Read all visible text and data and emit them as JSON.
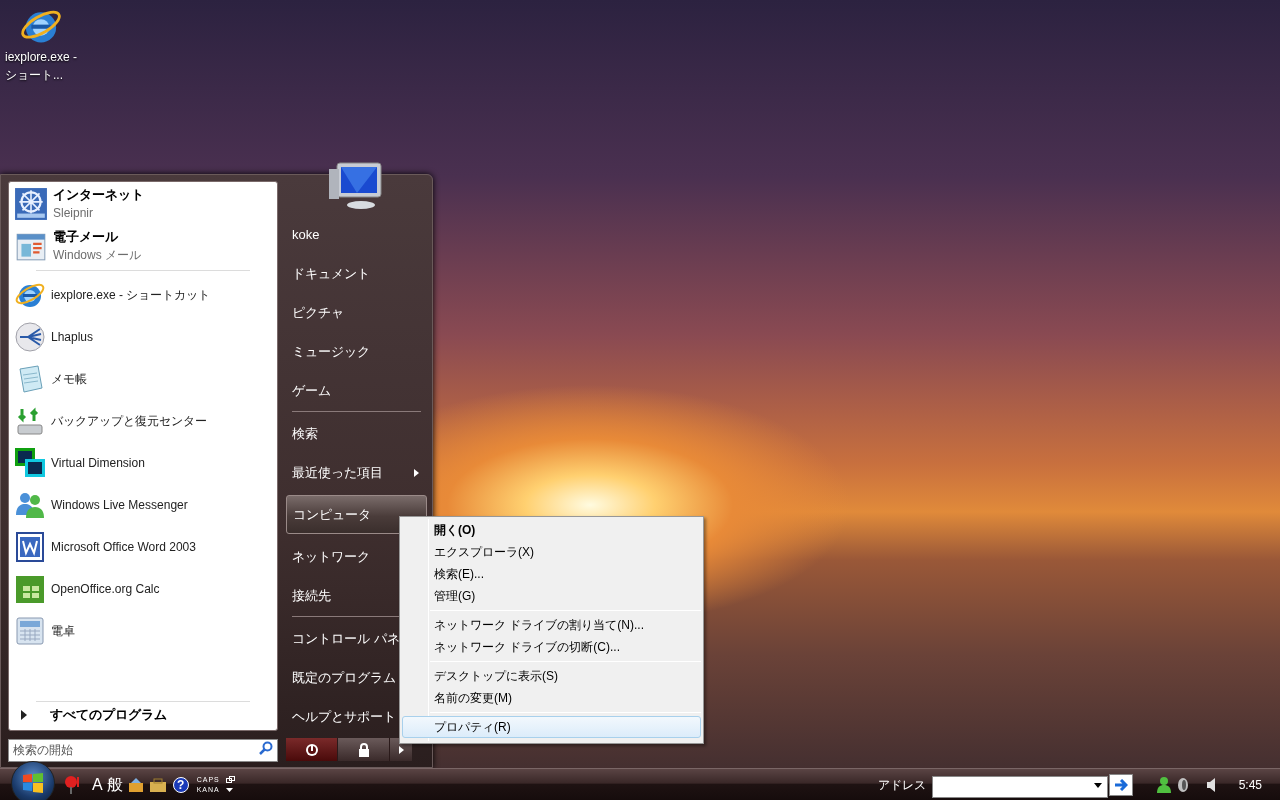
{
  "desktop_icons": [
    {
      "label": "iexplore.exe - ショート..."
    }
  ],
  "start_menu": {
    "pinned": [
      {
        "title": "インターネット",
        "subtitle": "Sleipnir"
      },
      {
        "title": "電子メール",
        "subtitle": "Windows メール"
      }
    ],
    "recent": [
      {
        "label": "iexplore.exe - ショートカット"
      },
      {
        "label": "Lhaplus"
      },
      {
        "label": "メモ帳"
      },
      {
        "label": "バックアップと復元センター"
      },
      {
        "label": "Virtual Dimension"
      },
      {
        "label": "Windows Live Messenger"
      },
      {
        "label": "Microsoft Office Word 2003"
      },
      {
        "label": "OpenOffice.org Calc"
      },
      {
        "label": "電卓"
      }
    ],
    "all_programs": {
      "label": "すべてのプログラム"
    },
    "search": {
      "placeholder": "検索の開始"
    },
    "place_groups": [
      {
        "items": [
          {
            "label": "koke",
            "selected": false
          },
          {
            "label": "ドキュメント",
            "selected": false
          },
          {
            "label": "ピクチャ",
            "selected": false
          },
          {
            "label": "ミュージック",
            "selected": false
          },
          {
            "label": "ゲーム",
            "selected": false
          }
        ]
      },
      {
        "items": [
          {
            "label": "検索",
            "selected": false
          },
          {
            "label": "最近使った項目",
            "has_submenu": true,
            "selected": false
          },
          {
            "label": "コンピュータ",
            "selected": true
          },
          {
            "label": "ネットワーク",
            "selected": false
          },
          {
            "label": "接続先",
            "selected": false
          }
        ]
      },
      {
        "items": [
          {
            "label": "コントロール パネ",
            "selected": false
          },
          {
            "label": "既定のプログラム",
            "selected": false
          },
          {
            "label": "ヘルプとサポート",
            "selected": false
          }
        ]
      }
    ]
  },
  "context_menu": {
    "groups": [
      {
        "items": [
          {
            "label": "開く(O)",
            "default": true,
            "selected": false
          },
          {
            "label": "エクスプローラ(X)",
            "default": false,
            "selected": false
          },
          {
            "label": "検索(E)...",
            "default": false,
            "selected": false
          },
          {
            "label": "管理(G)",
            "default": false,
            "selected": false
          }
        ]
      },
      {
        "items": [
          {
            "label": "ネットワーク ドライブの割り当て(N)...",
            "default": false,
            "selected": false
          },
          {
            "label": "ネットワーク ドライブの切断(C)...",
            "default": false,
            "selected": false
          }
        ]
      },
      {
        "items": [
          {
            "label": "デスクトップに表示(S)",
            "default": false,
            "selected": false
          },
          {
            "label": "名前の変更(M)",
            "default": false,
            "selected": false
          }
        ]
      },
      {
        "items": [
          {
            "label": "プロパティ(R)",
            "default": false,
            "selected": true
          }
        ]
      }
    ]
  },
  "taskbar": {
    "language_bar": [
      "A",
      "般"
    ],
    "help_glyph": "?",
    "keyboard_status": [
      "CAPS",
      "KANA"
    ],
    "address": {
      "label": "アドレス"
    },
    "clock": "5:45"
  }
}
